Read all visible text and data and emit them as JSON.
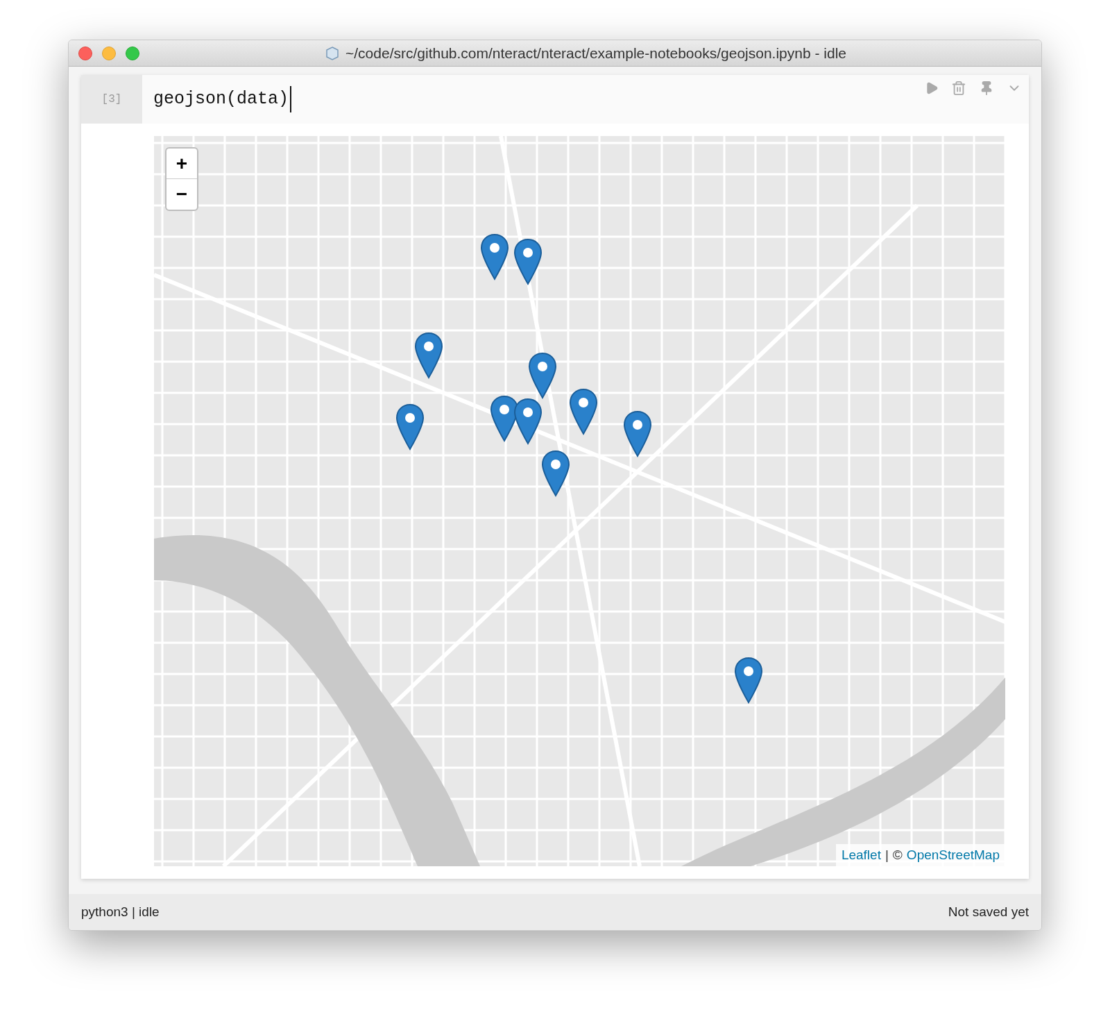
{
  "window": {
    "title": "~/code/src/github.com/nteract/nteract/example-notebooks/geojson.ipynb - idle"
  },
  "cell": {
    "prompt": "[3]",
    "code": "geojson(data)"
  },
  "map": {
    "zoom_in": "+",
    "zoom_out": "−",
    "attribution": {
      "link_1": "Leaflet",
      "separator": "|",
      "copyright": "©",
      "link_2": "OpenStreetMap"
    }
  },
  "status_bar": {
    "left": "python3 | idle",
    "right": "Not saved yet"
  }
}
